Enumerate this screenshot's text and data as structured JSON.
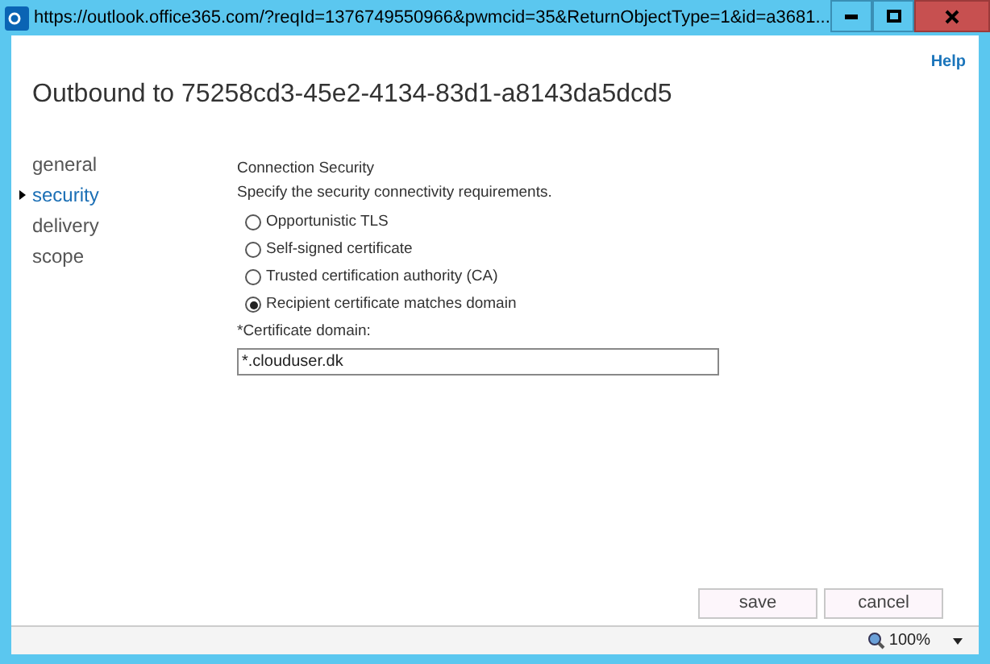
{
  "window": {
    "title": "https://outlook.office365.com/?reqId=1376749550966&pwmcid=35&ReturnObjectType=1&id=a3681..."
  },
  "help": "Help",
  "page_title": "Outbound to 75258cd3-45e2-4134-83d1-a8143da5dcd5",
  "nav": [
    {
      "label": "general",
      "selected": false
    },
    {
      "label": "security",
      "selected": true
    },
    {
      "label": "delivery",
      "selected": false
    },
    {
      "label": "scope",
      "selected": false
    }
  ],
  "section": {
    "heading": "Connection Security",
    "description": "Specify the security connectivity requirements.",
    "options": [
      {
        "label": "Opportunistic TLS",
        "selected": false
      },
      {
        "label": "Self-signed certificate",
        "selected": false
      },
      {
        "label": "Trusted certification authority (CA)",
        "selected": false
      },
      {
        "label": "Recipient certificate matches domain",
        "selected": true
      }
    ],
    "field_label": "*Certificate domain:",
    "field_value": "*.clouduser.dk"
  },
  "buttons": [
    "save",
    "cancel"
  ],
  "status_bar": {
    "zoom": "100%"
  }
}
